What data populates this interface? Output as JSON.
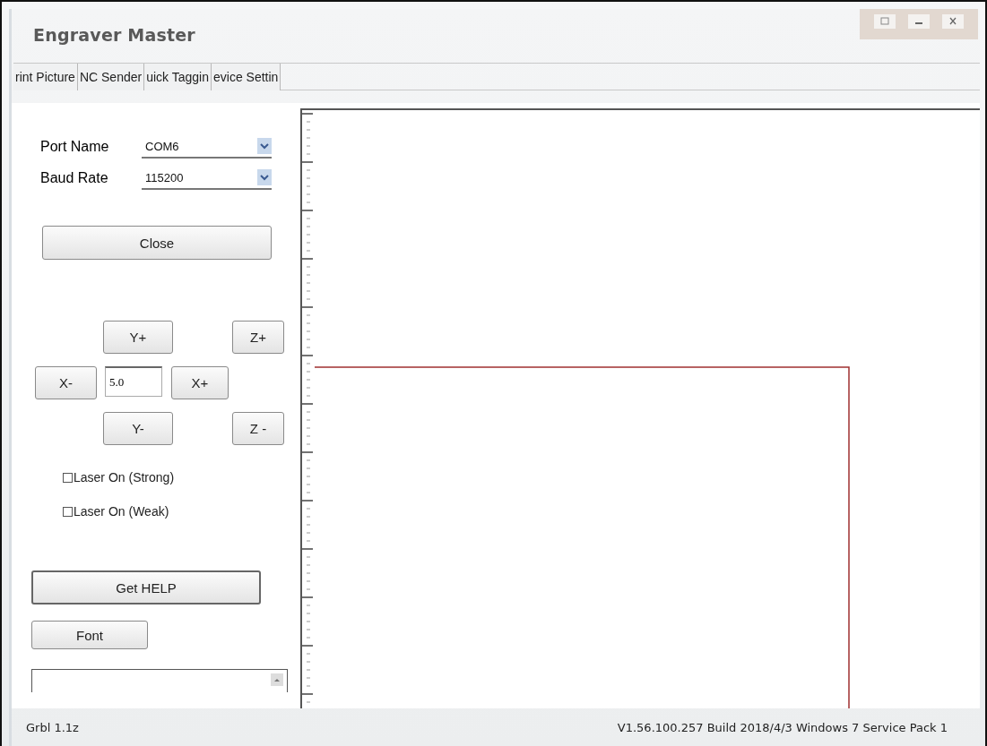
{
  "window": {
    "title": "Engraver Master"
  },
  "tabs": [
    {
      "label": "rint Picture"
    },
    {
      "label": "NC Sender"
    },
    {
      "label": "uick Taggin"
    },
    {
      "label": "evice Settin"
    }
  ],
  "connection": {
    "fields": [
      {
        "label": "Port Name",
        "value": "COM6"
      },
      {
        "label": "Baud Rate",
        "value": "115200"
      }
    ],
    "button": "Close"
  },
  "jog": {
    "y_plus": "Y+",
    "z_plus": "Z+",
    "x_minus": "X-",
    "step": "5.0",
    "x_plus": "X+",
    "y_minus": "Y-",
    "z_minus": "Z -"
  },
  "laser": [
    {
      "label": "Laser On (Strong)",
      "checked": false
    },
    {
      "label": "Laser On (Weak)",
      "checked": false
    }
  ],
  "help_button": "Get HELP",
  "font_button": "Font",
  "status_bar": {
    "left": "Grbl 1.1z",
    "right": "V1.56.100.257 Build 2018/4/3 Windows 7 Service Pack 1"
  }
}
